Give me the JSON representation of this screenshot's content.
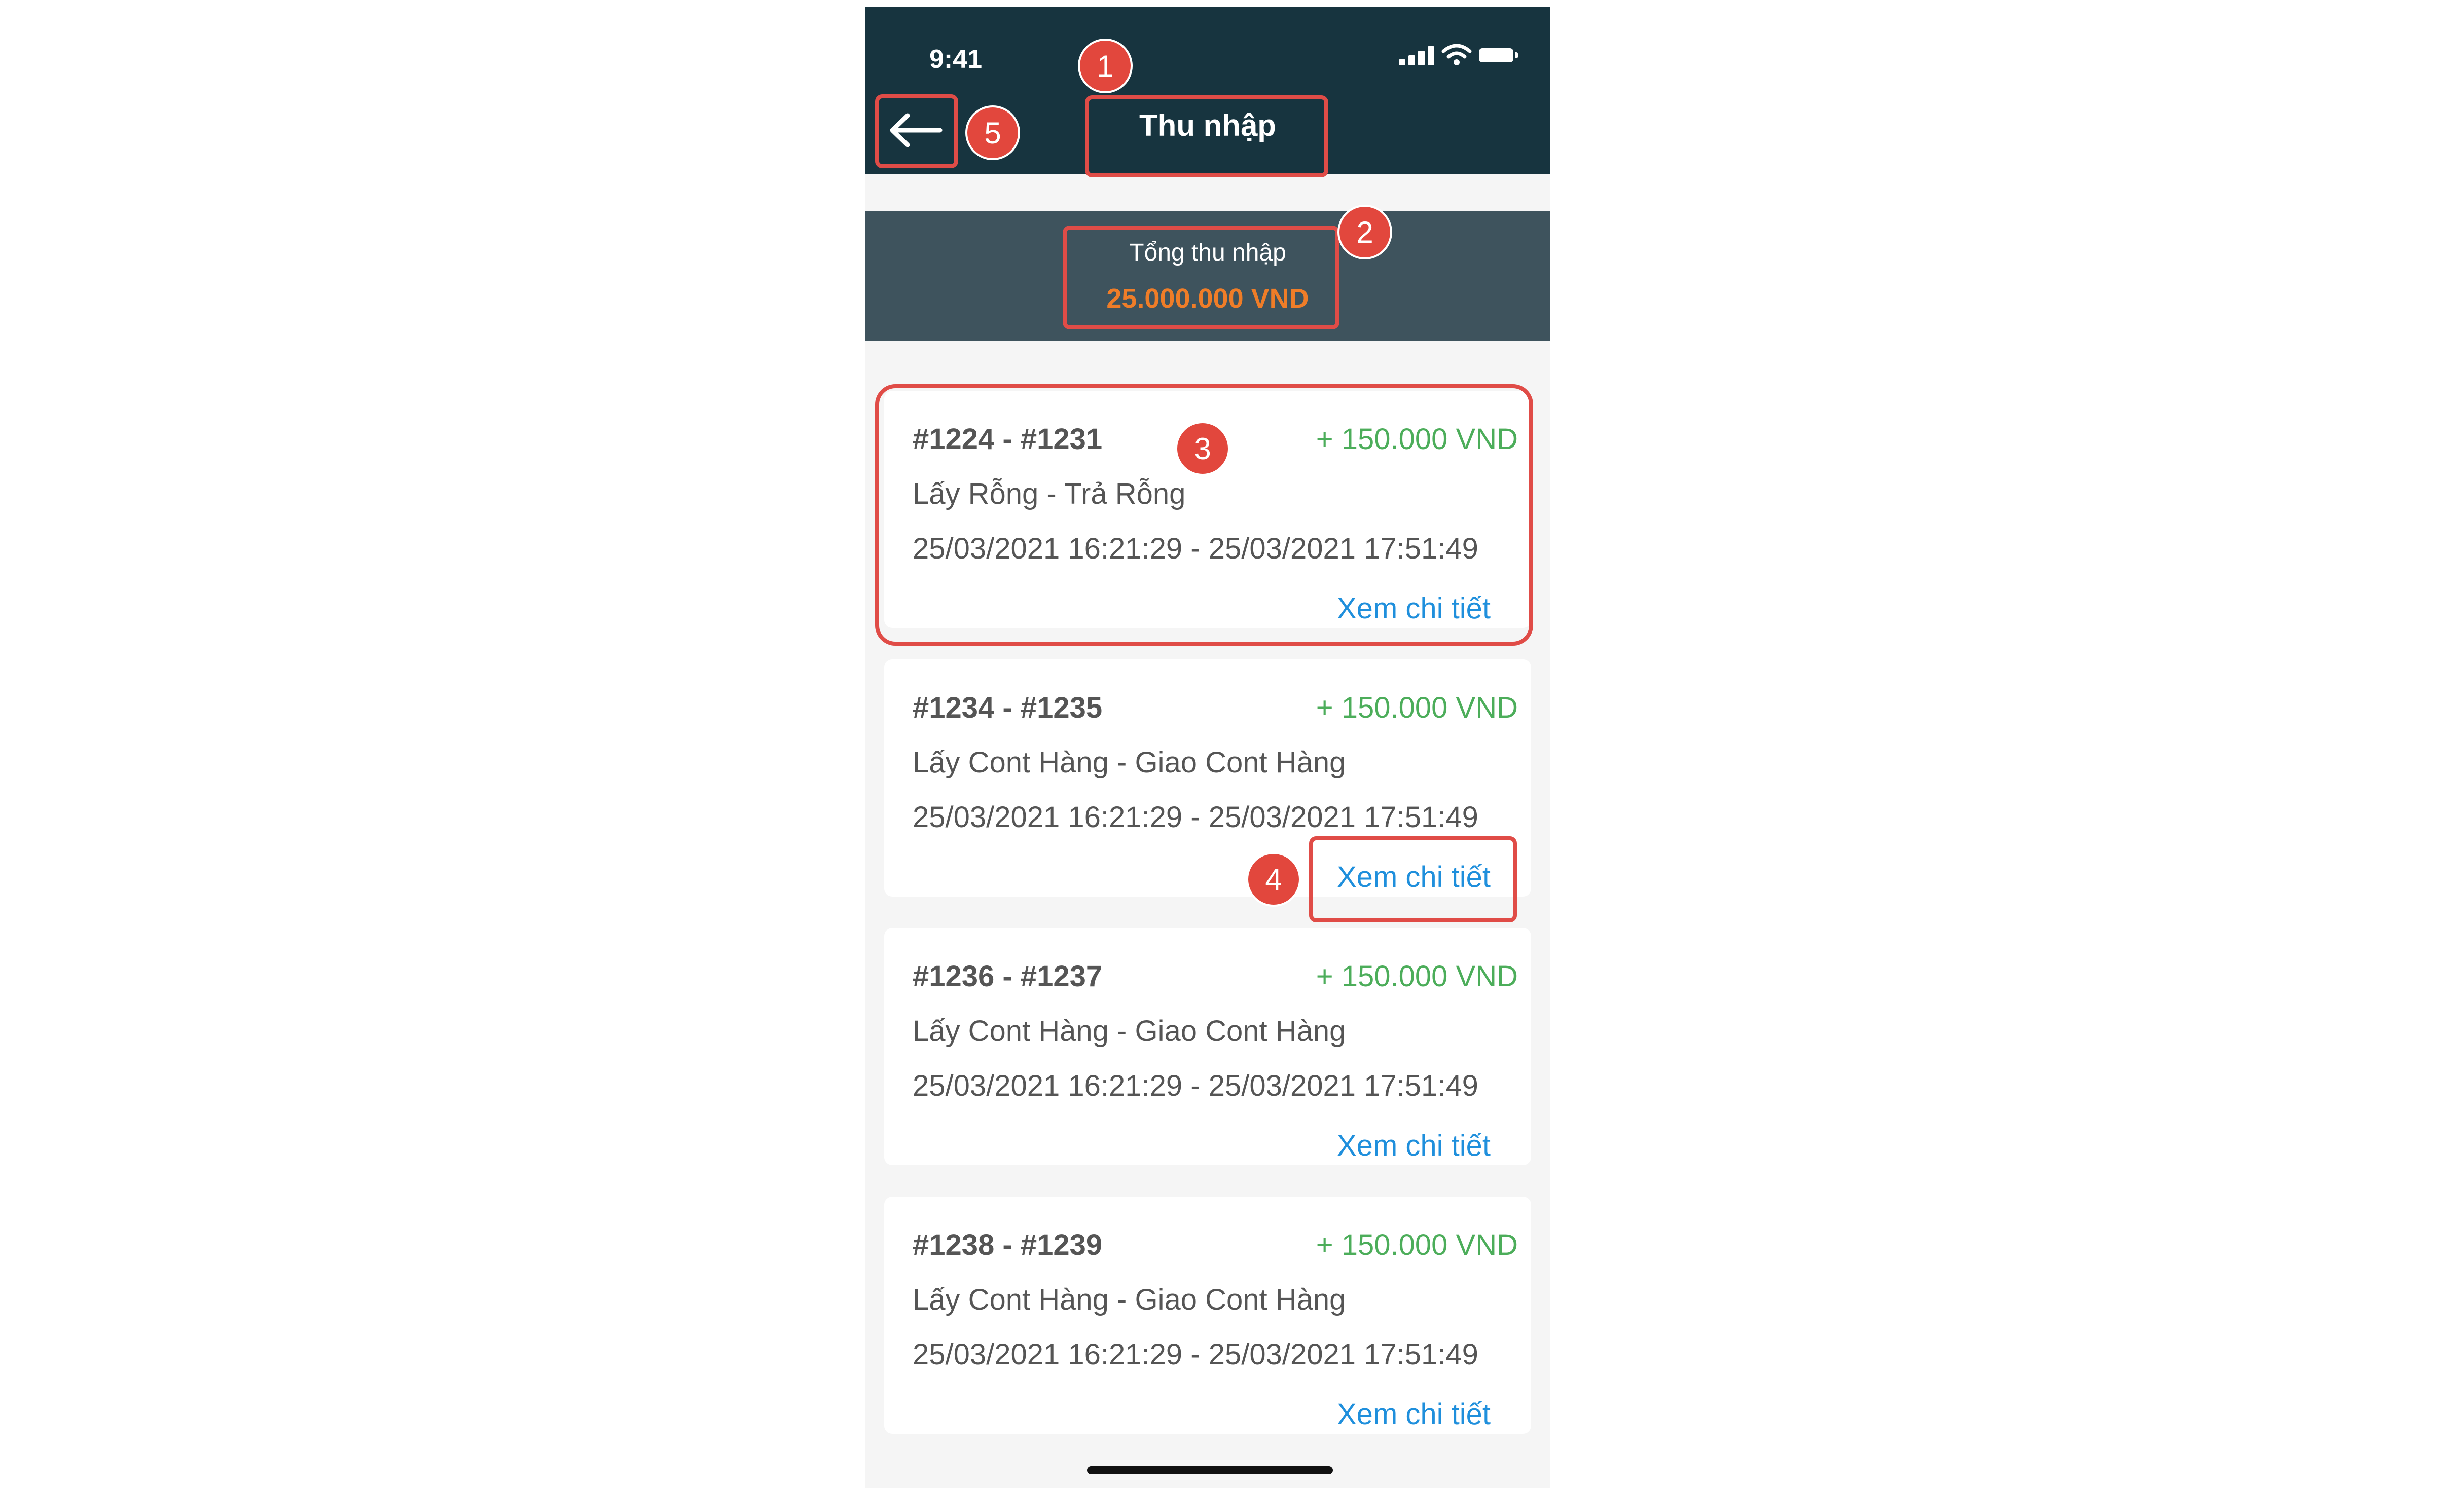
{
  "status_bar": {
    "time": "9:41"
  },
  "header": {
    "title": "Thu nhập"
  },
  "summary": {
    "label": "Tổng thu nhập",
    "value": "25.000.000 VND"
  },
  "cards": [
    {
      "ids": "#1224 - #1231",
      "amount": "+ 150.000 VND",
      "route": "Lấy Rỗng - Trả Rỗng",
      "time_range": "25/03/2021 16:21:29 - 25/03/2021 17:51:49",
      "link": "Xem chi tiết"
    },
    {
      "ids": "#1234 - #1235",
      "amount": "+ 150.000 VND",
      "route": "Lấy Cont Hàng - Giao Cont Hàng",
      "time_range": "25/03/2021 16:21:29 - 25/03/2021 17:51:49",
      "link": "Xem chi tiết"
    },
    {
      "ids": "#1236 - #1237",
      "amount": "+ 150.000 VND",
      "route": "Lấy Cont Hàng - Giao Cont Hàng",
      "time_range": "25/03/2021 16:21:29 - 25/03/2021 17:51:49",
      "link": "Xem chi tiết"
    },
    {
      "ids": "#1238 - #1239",
      "amount": "+ 150.000 VND",
      "route": "Lấy Cont Hàng - Giao Cont Hàng",
      "time_range": "25/03/2021 16:21:29 - 25/03/2021 17:51:49",
      "link": "Xem chi tiết"
    }
  ],
  "annotations": [
    "1",
    "2",
    "3",
    "4",
    "5"
  ],
  "colors": {
    "header_bg": "#17343f",
    "summary_bg": "#3e535d",
    "summary_value": "#ef7d28",
    "amount_positive": "#4cad5a",
    "link": "#1f8fdc",
    "annotation": "#e2473d"
  },
  "icons": {
    "back": "arrow-left-icon",
    "signal": "signal-bars-icon",
    "wifi": "wifi-icon",
    "battery": "battery-icon"
  }
}
